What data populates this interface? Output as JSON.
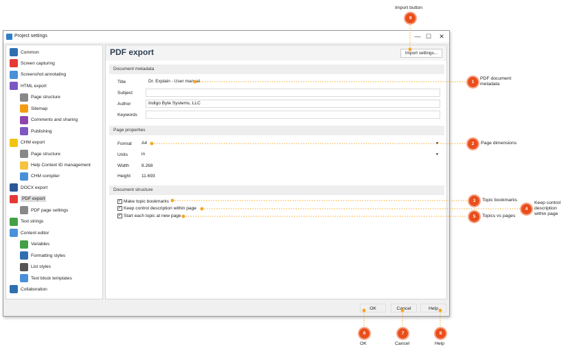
{
  "window": {
    "title": "Project settings",
    "minimize": "—",
    "maximize": "☐",
    "close": "✕"
  },
  "sidebar": {
    "items": [
      {
        "label": "Common",
        "icon": "gear-icon",
        "color": "#2f6fb0"
      },
      {
        "label": "Screen capturing",
        "icon": "screen-capture-icon",
        "color": "#e53935"
      },
      {
        "label": "Screenshot annotating",
        "icon": "annotate-icon",
        "color": "#4a90d9"
      },
      {
        "label": "HTML export",
        "icon": "html-icon",
        "color": "#7b57c4"
      },
      {
        "label": "Page structure",
        "icon": "page-structure-icon",
        "color": "#888888"
      },
      {
        "label": "Sitemap",
        "icon": "sitemap-icon",
        "color": "#f39c12"
      },
      {
        "label": "Comments and sharing",
        "icon": "comments-icon",
        "color": "#8e44ad"
      },
      {
        "label": "Publishing",
        "icon": "cloud-icon",
        "color": "#7e57c2"
      },
      {
        "label": "CHM export",
        "icon": "chm-icon",
        "color": "#f1c40f"
      },
      {
        "label": "Page structure",
        "icon": "page-structure-icon",
        "color": "#888888"
      },
      {
        "label": "Help Context ID management",
        "icon": "folder-icon",
        "color": "#f5c342"
      },
      {
        "label": "CHM compiler",
        "icon": "compiler-icon",
        "color": "#4a90d9"
      },
      {
        "label": "DOCX export",
        "icon": "docx-icon",
        "color": "#2b5797"
      },
      {
        "label": "PDF export",
        "icon": "pdf-icon",
        "color": "#e53935"
      },
      {
        "label": "PDF page settings",
        "icon": "page-settings-icon",
        "color": "#888888"
      },
      {
        "label": "Text strings",
        "icon": "text-strings-icon",
        "color": "#43a047"
      },
      {
        "label": "Content editor",
        "icon": "editor-icon",
        "color": "#4a90d9"
      },
      {
        "label": "Variables",
        "icon": "variables-icon",
        "color": "#43a047"
      },
      {
        "label": "Formatting styles",
        "icon": "formatting-icon",
        "color": "#2f6fb0"
      },
      {
        "label": "List styles",
        "icon": "list-icon",
        "color": "#555555"
      },
      {
        "label": "Text block templates",
        "icon": "template-icon",
        "color": "#4a90d9"
      },
      {
        "label": "Collaboration",
        "icon": "collaboration-icon",
        "color": "#2f6fb0"
      }
    ]
  },
  "panel": {
    "title": "PDF export",
    "import_button": "Import settings...",
    "metadata": {
      "section": "Document metadata",
      "title_label": "Title",
      "title_value": "Dr. Explain - User manual",
      "subject_label": "Subject",
      "subject_value": "",
      "author_label": "Author",
      "author_value": "Indigo Byte Systems, LLC",
      "keywords_label": "Keywords",
      "keywords_value": ""
    },
    "page": {
      "section": "Page properties",
      "format_label": "Format",
      "format_value": "A4",
      "units_label": "Units",
      "units_value": "in",
      "width_label": "Width",
      "width_value": "8.268",
      "height_label": "Height",
      "height_value": "11.693"
    },
    "structure": {
      "section": "Document structure",
      "bookmarks": "Make topic bookmarks",
      "keep_control": "Keep control description within page",
      "new_page": "Start each topic at new page",
      "check_mark": "✓"
    }
  },
  "footer": {
    "ok": "OK",
    "cancel": "Cancel",
    "help": "Help"
  },
  "callouts": {
    "import": {
      "number": "9",
      "label": "Import button"
    },
    "metadata": {
      "number": "1",
      "label": "PDF document metadata"
    },
    "dimensions": {
      "number": "2",
      "label": "Page dimensions"
    },
    "bookmarks": {
      "number": "3",
      "label": "Topic bookmarks"
    },
    "keep": {
      "number": "4",
      "label": "Keep control description within page"
    },
    "topics": {
      "number": "5",
      "label": "Topics vs pages"
    },
    "ok": {
      "number": "6",
      "label": "OK"
    },
    "cancel": {
      "number": "7",
      "label": "Cancel"
    },
    "help": {
      "number": "8",
      "label": "Help"
    }
  },
  "colors": {
    "badge": "#e94e1b",
    "leader": "#f5a623",
    "title": "#2d3e50"
  }
}
